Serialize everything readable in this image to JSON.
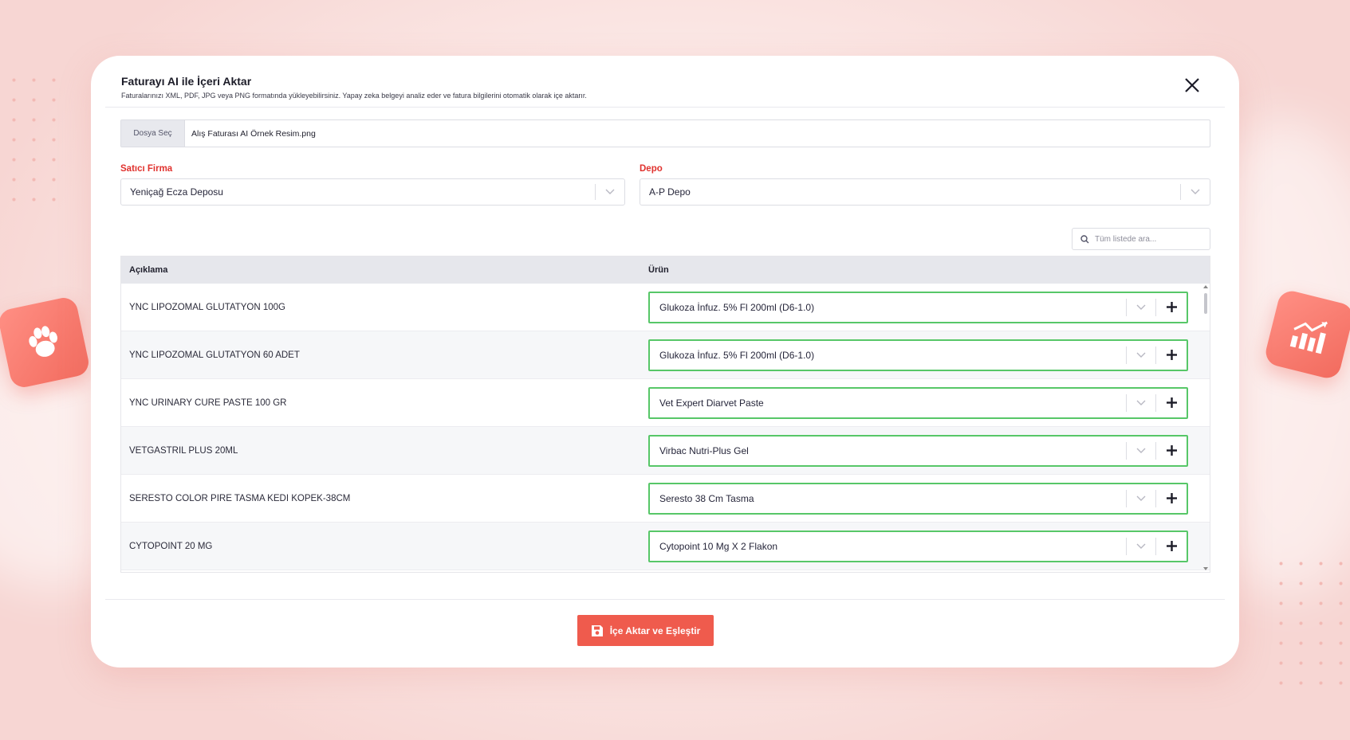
{
  "modal": {
    "title": "Faturayı AI ile İçeri Aktar",
    "subtitle": "Faturalarınızı XML, PDF, JPG veya PNG formatında yükleyebilirsiniz. Yapay zeka belgeyi analiz eder ve fatura bilgilerini otomatik olarak içe aktarır.",
    "close_icon": "close-icon"
  },
  "file": {
    "button_label": "Dosya Seç",
    "file_name": "Alış Faturası AI Örnek Resim.png"
  },
  "seller": {
    "label": "Satıcı Firma",
    "value": "Yeniçağ Ecza Deposu"
  },
  "warehouse": {
    "label": "Depo",
    "value": "A-P Depo"
  },
  "search": {
    "placeholder": "Tüm listede ara..."
  },
  "table": {
    "headers": {
      "description": "Açıklama",
      "product": "Ürün"
    },
    "rows": [
      {
        "description": "YNC LIPOZOMAL GLUTATYON 100G",
        "product": "Glukoza İnfuz. 5% Fl 200ml (D6-1.0)"
      },
      {
        "description": "YNC LIPOZOMAL GLUTATYON 60 ADET",
        "product": "Glukoza İnfuz. 5% Fl 200ml (D6-1.0)"
      },
      {
        "description": "YNC URINARY CURE PASTE 100 GR",
        "product": "Vet Expert Diarvet Paste"
      },
      {
        "description": "VETGASTRIL PLUS 20ML",
        "product": "Virbac Nutri-Plus Gel"
      },
      {
        "description": "SERESTO COLOR PIRE TASMA KEDI KOPEK-38CM",
        "product": "Seresto 38 Cm Tasma"
      },
      {
        "description": "CYTOPOINT 20 MG",
        "product": "Cytopoint 10 Mg X 2 Flakon"
      }
    ]
  },
  "actions": {
    "submit_label": "İçe Aktar ve Eşleştir",
    "submit_icon": "save-icon"
  },
  "colors": {
    "accent": "#ef5b4d",
    "required_label": "#e0322e",
    "matched_border": "#57c768"
  }
}
